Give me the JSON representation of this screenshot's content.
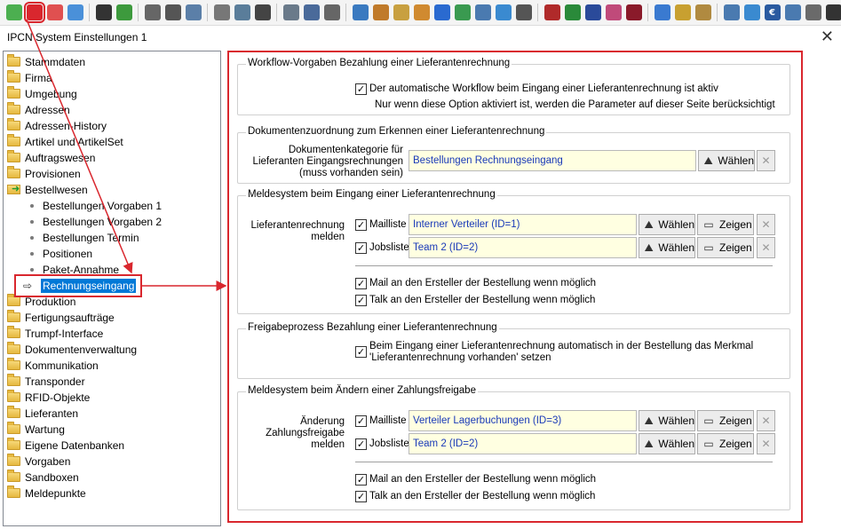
{
  "window": {
    "title": "IPCN System Einstellungen 1",
    "close_glyph": "✕"
  },
  "toolbar": {
    "icons": [
      {
        "name": "settings-green-icon",
        "color": "#4caf50"
      },
      {
        "name": "settings-red-icon",
        "color": "#d9272e",
        "active": true
      },
      {
        "name": "settings-red2-icon",
        "color": "#e05050"
      },
      {
        "name": "settings-blue-icon",
        "color": "#4a90d9"
      },
      {
        "name": "user-black-icon",
        "color": "#333333"
      },
      {
        "name": "user-green-icon",
        "color": "#3d9a3d"
      },
      {
        "name": "printer-icon",
        "color": "#666666"
      },
      {
        "name": "archive-icon",
        "color": "#555555"
      },
      {
        "name": "document-icon",
        "color": "#5b7fa8"
      },
      {
        "name": "clock-icon",
        "color": "#777777"
      },
      {
        "name": "globe-icon",
        "color": "#5a7d9a"
      },
      {
        "name": "counter-icon",
        "color": "#444444"
      },
      {
        "name": "people-icon",
        "color": "#6a7a8a"
      },
      {
        "name": "edit-icon",
        "color": "#4a6a9a"
      },
      {
        "name": "gear-icon",
        "color": "#666666"
      },
      {
        "name": "tools-icon",
        "color": "#3a7ac0"
      },
      {
        "name": "search-icon",
        "color": "#c07a2a"
      },
      {
        "name": "box-icon",
        "color": "#c8a040"
      },
      {
        "name": "group-icon",
        "color": "#d08a30"
      },
      {
        "name": "add-circle-icon",
        "color": "#2a6ad0"
      },
      {
        "name": "sync-icon",
        "color": "#3a9a50"
      },
      {
        "name": "inbox-icon",
        "color": "#4a7ab0"
      },
      {
        "name": "star-icon",
        "color": "#3a8ad0"
      },
      {
        "name": "calculator-icon",
        "color": "#555555"
      },
      {
        "name": "book-red-icon",
        "color": "#b02a2a"
      },
      {
        "name": "book-green-icon",
        "color": "#2a8a3a"
      },
      {
        "name": "book-blue-icon",
        "color": "#2a4a9a"
      },
      {
        "name": "book-pink-icon",
        "color": "#c04a7a"
      },
      {
        "name": "book-darkred-icon",
        "color": "#8a1a2a"
      },
      {
        "name": "chart-pie-icon",
        "color": "#3a7ad0"
      },
      {
        "name": "coins-icon",
        "color": "#c8a030"
      },
      {
        "name": "note-icon",
        "color": "#b08a40"
      },
      {
        "name": "export-icon",
        "color": "#4a7ab0"
      },
      {
        "name": "chat-icon",
        "color": "#3a8ad0"
      },
      {
        "name": "euro-icon",
        "color": "#2a5aa0",
        "glyph": "€"
      },
      {
        "name": "screen-icon",
        "color": "#4a7ab0"
      },
      {
        "name": "mail-icon",
        "color": "#6a6a6a"
      },
      {
        "name": "phone-icon",
        "color": "#333333"
      },
      {
        "name": "app-icon",
        "color": "#3a6ad0"
      }
    ]
  },
  "tree": {
    "items": [
      {
        "label": "Stammdaten",
        "type": "folder"
      },
      {
        "label": "Firma",
        "type": "folder"
      },
      {
        "label": "Umgebung",
        "type": "folder"
      },
      {
        "label": "Adressen",
        "type": "folder"
      },
      {
        "label": "Adressen-History",
        "type": "folder"
      },
      {
        "label": "Artikel und ArtikelSet",
        "type": "folder"
      },
      {
        "label": "Auftragswesen",
        "type": "folder"
      },
      {
        "label": "Provisionen",
        "type": "folder"
      },
      {
        "label": "Bestellwesen",
        "type": "folder-open"
      },
      {
        "label": "Bestellungen Vorgaben 1",
        "type": "child"
      },
      {
        "label": "Bestellungen Vorgaben 2",
        "type": "child"
      },
      {
        "label": "Bestellungen Termin",
        "type": "child"
      },
      {
        "label": "Positionen",
        "type": "child"
      },
      {
        "label": "Paket-Annahme",
        "type": "child"
      },
      {
        "label": "Rechnungseingang",
        "type": "selected"
      },
      {
        "label": "Produktion",
        "type": "folder"
      },
      {
        "label": "Fertigungsaufträge",
        "type": "folder"
      },
      {
        "label": "Trumpf-Interface",
        "type": "folder"
      },
      {
        "label": "Dokumentenverwaltung",
        "type": "folder"
      },
      {
        "label": "Kommunikation",
        "type": "folder"
      },
      {
        "label": "Transponder",
        "type": "folder"
      },
      {
        "label": "RFID-Objekte",
        "type": "folder"
      },
      {
        "label": "Lieferanten",
        "type": "folder"
      },
      {
        "label": "Wartung",
        "type": "folder"
      },
      {
        "label": "Eigene Datenbanken",
        "type": "folder"
      },
      {
        "label": "Vorgaben",
        "type": "folder"
      },
      {
        "label": "Sandboxen",
        "type": "folder"
      },
      {
        "label": "Meldepunkte",
        "type": "folder"
      }
    ]
  },
  "groups": {
    "workflow": {
      "title": "Workflow-Vorgaben Bezahlung einer Lieferantenrechnung",
      "checkbox_label": "Der automatische Workflow beim Eingang einer Lieferantenrechnung ist aktiv",
      "checked": true,
      "hint": "Nur wenn diese Option aktiviert ist, werden die Parameter auf dieser Seite berücksichtigt"
    },
    "doczuordnung": {
      "title": "Dokumentenzuordnung zum Erkennen einer Lieferantenrechnung",
      "label_line1": "Dokumentenkategorie für",
      "label_line2": "Lieferanten Eingangsrechnungen",
      "label_line3": "(muss vorhanden sein)",
      "value": "Bestellungen Rechnungseingang"
    },
    "melde_eingang": {
      "title": "Meldesystem beim Eingang einer Lieferantenrechnung",
      "label_line1": "Lieferantenrechnung",
      "label_line2": "melden",
      "mailliste_label": "Mailliste",
      "mailliste_value": "Interner Verteiler (ID=1)",
      "jobsliste_label": "Jobsliste",
      "jobsliste_value": "Team 2 (ID=2)",
      "mail_opt": "Mail an den Ersteller der  Bestellung wenn möglich",
      "talk_opt": "Talk an den Ersteller der  Bestellung wenn möglich"
    },
    "freigabe": {
      "title": "Freigabeprozess Bezahlung einer Lieferantenrechnung",
      "checkbox_line1": "Beim Eingang einer Lieferantenrechnung automatisch in der Bestellung das Merkmal",
      "checkbox_line2": "'Lieferantenrechnung vorhanden' setzen"
    },
    "melde_aendern": {
      "title": "Meldesystem beim Ändern einer Zahlungsfreigabe",
      "label_line1": "Änderung",
      "label_line2": "Zahlungsfreigabe",
      "label_line3": "melden",
      "mailliste_label": "Mailliste",
      "mailliste_value": "Verteiler Lagerbuchungen (ID=3)",
      "jobsliste_label": "Jobsliste",
      "jobsliste_value": "Team 2 (ID=2)",
      "mail_opt": "Mail an den Ersteller der  Bestellung wenn möglich",
      "talk_opt": "Talk an den Ersteller der  Bestellung wenn möglich"
    }
  },
  "buttons": {
    "waehlen": "Wählen",
    "zeigen": "Zeigen",
    "clear_glyph": "✕",
    "check_glyph": "✓"
  },
  "colors": {
    "accent_red": "#d9272e",
    "selection_blue": "#0078d7",
    "field_bg": "#ffffe1",
    "field_text": "#1a3ab8"
  }
}
